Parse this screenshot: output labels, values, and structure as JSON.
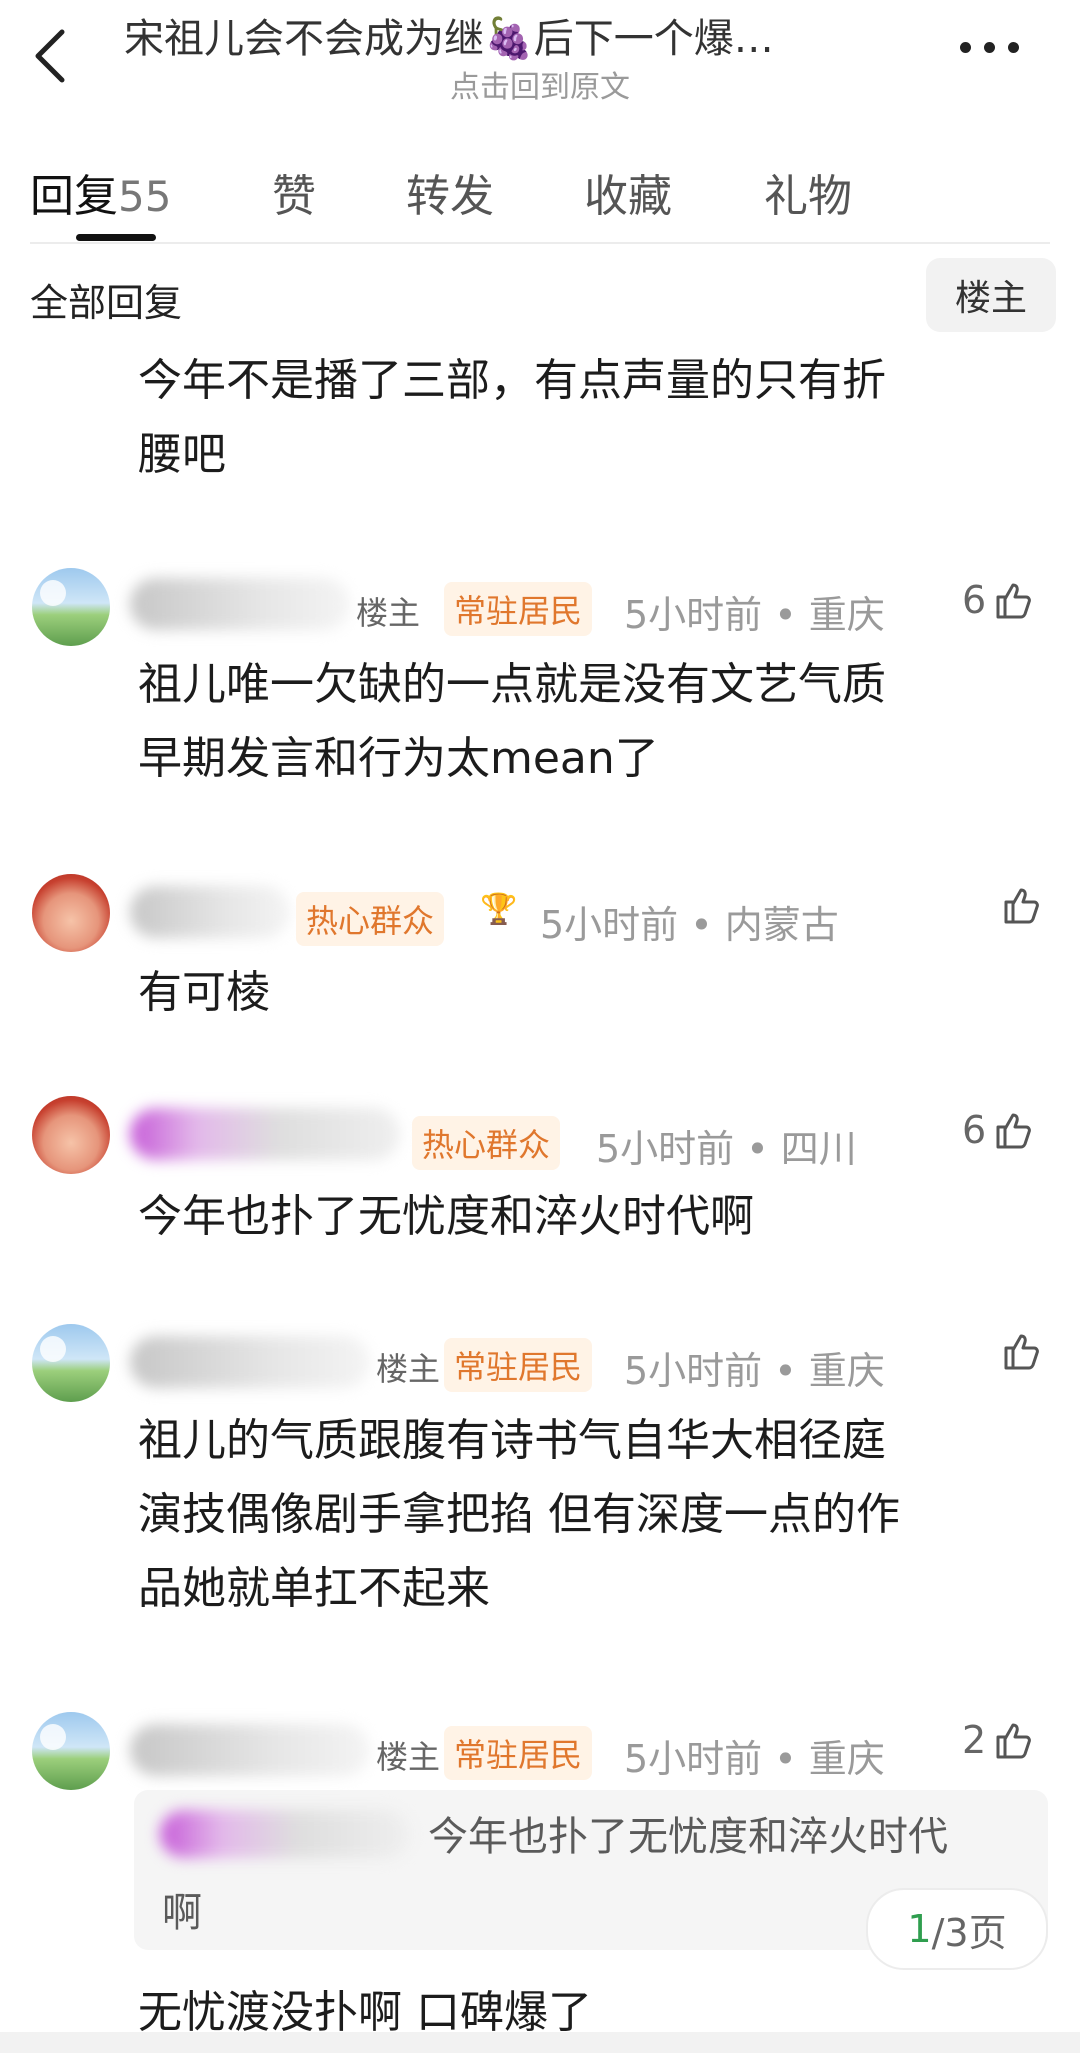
{
  "header": {
    "title": "宋祖儿会不会成为继🍇后下一个爆…",
    "subtitle": "点击回到原文"
  },
  "tabs": [
    {
      "label": "回复",
      "count": "55"
    },
    {
      "label": "赞"
    },
    {
      "label": "转发"
    },
    {
      "label": "收藏"
    },
    {
      "label": "礼物"
    }
  ],
  "section": {
    "title": "全部回复",
    "op_badge": "楼主"
  },
  "top_text": {
    "line1": "今年不是播了三部，有点声量的只有折",
    "line2": "腰吧"
  },
  "comments": [
    {
      "louzhu": "楼主",
      "badge": "常驻居民",
      "time": "5小时前 • 重庆",
      "likes": "6",
      "lines": [
        "祖儿唯一欠缺的一点就是没有文艺气质",
        "早期发言和行为太mean了"
      ]
    },
    {
      "badge": "热心群众",
      "time": "5小时前 • 内蒙古",
      "likes": "",
      "lines": [
        "有可棱"
      ]
    },
    {
      "badge": "热心群众",
      "time": "5小时前 • 四川",
      "likes": "6",
      "lines": [
        "今年也扑了无忧度和淬火时代啊"
      ]
    },
    {
      "louzhu": "楼主",
      "badge": "常驻居民",
      "time": "5小时前 • 重庆",
      "likes": "",
      "lines": [
        "祖儿的气质跟腹有诗书气自华大相径庭",
        "演技偶像剧手拿把掐 但有深度一点的作",
        "品她就单扛不起来"
      ]
    },
    {
      "louzhu": "楼主",
      "badge": "常驻居民",
      "time": "5小时前 • 重庆",
      "likes": "2",
      "quote_line1": "今年也扑了无忧度和淬火时代",
      "quote_line2": "啊",
      "pager_cur": "1",
      "pager_rest": "/3页",
      "lines": [
        "无忧渡没扑啊 口碑爆了"
      ]
    }
  ],
  "icons": {
    "back": "chevron-left-icon",
    "more": "more-dots-icon",
    "like": "thumb-up-icon",
    "trophy": "trophy-icon"
  },
  "colors": {
    "badge_text": "#e0772d",
    "badge_bg": "#fff3e6",
    "pager_current": "#2f9e4f"
  }
}
